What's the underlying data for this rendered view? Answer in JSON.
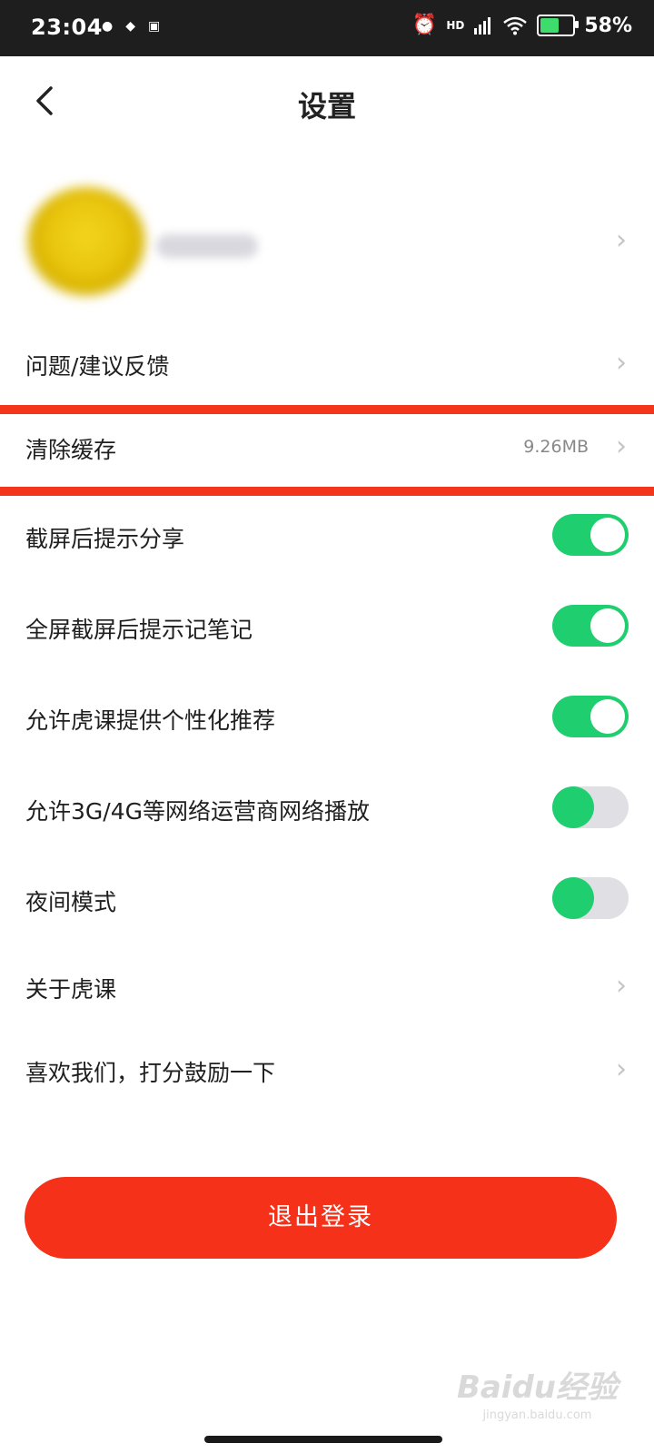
{
  "status_bar": {
    "time": "23:04",
    "hd_label": "HD",
    "battery_percent": "58%",
    "battery_level": 0.58,
    "icons": [
      "notification-icon",
      "shield-icon",
      "card-icon",
      "alarm-icon",
      "signal-icon",
      "wifi-icon",
      "battery-charging-icon"
    ]
  },
  "header": {
    "title": "设置",
    "back_icon": "chevron-left-icon"
  },
  "rows": {
    "feedback": {
      "label": "问题/建议反馈"
    },
    "clear_cache": {
      "label": "清除缓存",
      "value": "9.26MB"
    },
    "screenshot_share": {
      "label": "截屏后提示分享",
      "on": true
    },
    "fullscreen_note": {
      "label": "全屏截屏后提示记笔记",
      "on": true
    },
    "personalized": {
      "label": "允许虎课提供个性化推荐",
      "on": true
    },
    "mobile_data": {
      "label": "允许3G/4G等网络运营商网络播放",
      "on": false
    },
    "night_mode": {
      "label": "夜间模式",
      "on": false
    },
    "about": {
      "label": "关于虎课"
    },
    "rate": {
      "label": "喜欢我们，打分鼓励一下"
    }
  },
  "logout": {
    "label": "退出登录"
  },
  "colors": {
    "accent": "#f5311a",
    "toggle_on": "#1fcf6f",
    "highlight": "#f2351b"
  },
  "watermark": {
    "main": "Baidu经验",
    "sub": "jingyan.baidu.com"
  }
}
